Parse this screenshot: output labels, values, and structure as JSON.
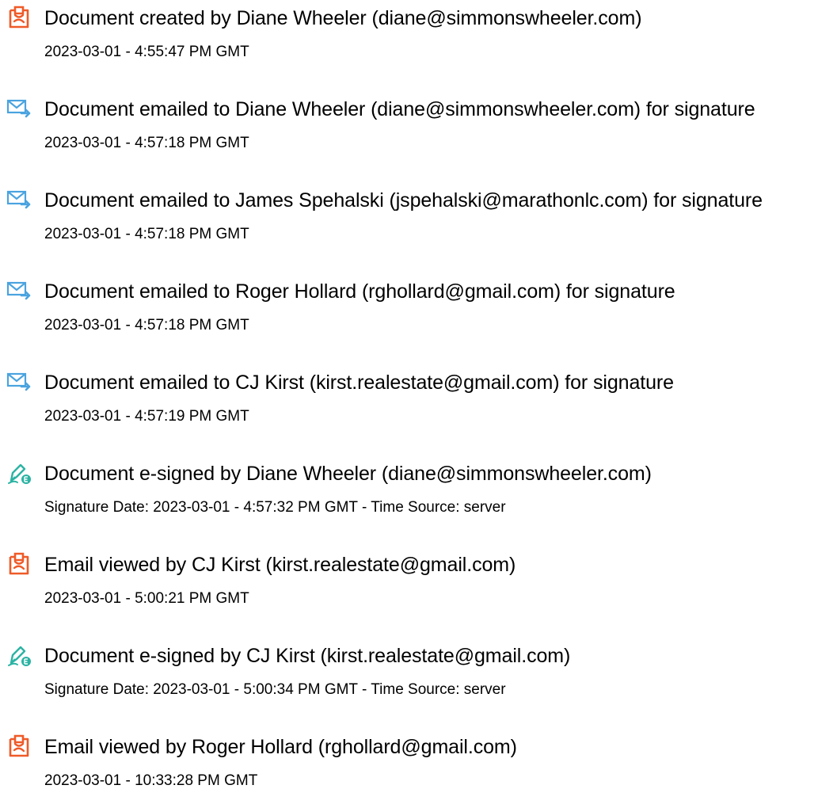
{
  "events": [
    {
      "icon": "document-created-icon",
      "title": "Document created by Diane Wheeler (diane@simmonswheeler.com)",
      "detail": "2023-03-01 - 4:55:47 PM GMT"
    },
    {
      "icon": "email-sent-icon",
      "title": "Document emailed to Diane Wheeler (diane@simmonswheeler.com) for signature",
      "detail": "2023-03-01 - 4:57:18 PM GMT"
    },
    {
      "icon": "email-sent-icon",
      "title": "Document emailed to James Spehalski (jspehalski@marathonlc.com) for signature",
      "detail": "2023-03-01 - 4:57:18 PM GMT"
    },
    {
      "icon": "email-sent-icon",
      "title": "Document emailed to Roger Hollard (rghollard@gmail.com) for signature",
      "detail": "2023-03-01 - 4:57:18 PM GMT"
    },
    {
      "icon": "email-sent-icon",
      "title": "Document emailed to CJ Kirst (kirst.realestate@gmail.com) for signature",
      "detail": "2023-03-01 - 4:57:19 PM GMT"
    },
    {
      "icon": "e-sign-pen-icon",
      "title": "Document e-signed by Diane Wheeler (diane@simmonswheeler.com)",
      "detail": "Signature Date: 2023-03-01 - 4:57:32 PM GMT - Time Source: server"
    },
    {
      "icon": "document-viewed-icon",
      "title": "Email viewed by CJ Kirst (kirst.realestate@gmail.com)",
      "detail": "2023-03-01 - 5:00:21 PM GMT"
    },
    {
      "icon": "e-sign-pen-icon",
      "title": "Document e-signed by CJ Kirst (kirst.realestate@gmail.com)",
      "detail": "Signature Date: 2023-03-01 - 5:00:34 PM GMT - Time Source: server"
    },
    {
      "icon": "document-viewed-icon",
      "title": "Email viewed by Roger Hollard (rghollard@gmail.com)",
      "detail": "2023-03-01 - 10:33:28 PM GMT"
    }
  ],
  "colors": {
    "doc_icon": "#ef5a28",
    "mail_icon": "#4aa3df",
    "sign_icon": "#2bb3a3",
    "text": "#000000"
  }
}
